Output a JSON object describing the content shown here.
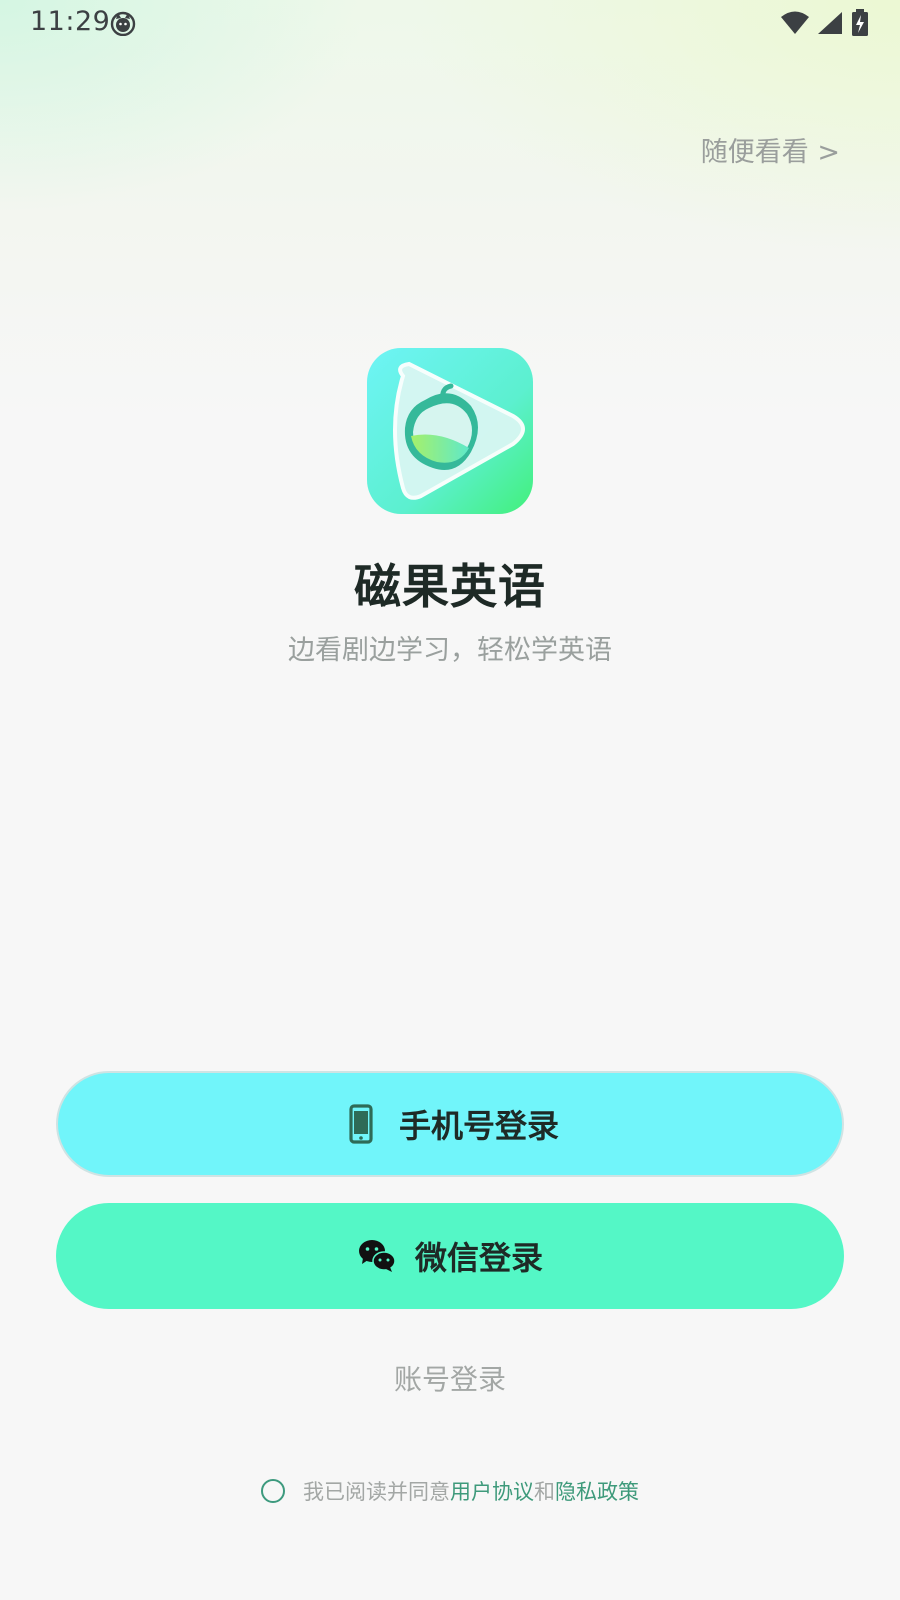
{
  "status_bar": {
    "time": "11:29",
    "icons": [
      "cat-notification-icon",
      "wifi-icon",
      "cell-signal-icon",
      "battery-charging-icon"
    ]
  },
  "skip": {
    "label": "随便看看 >"
  },
  "app": {
    "name": "磁果英语",
    "slogan": "边看剧边学习，轻松学英语",
    "logo_icon": "ciguo-logo-icon"
  },
  "buttons": {
    "phone_login": "手机号登录",
    "phone_icon": "smartphone-icon",
    "wechat_login": "微信登录",
    "wechat_icon": "wechat-icon",
    "account_login": "账号登录"
  },
  "agreement": {
    "prefix": "我已阅读并同意",
    "user_agreement": "用户协议",
    "conjunction": "和",
    "privacy_policy": "隐私政策"
  },
  "colors": {
    "phone_button": "#71f5fa",
    "wechat_button": "#54f7c6",
    "link": "#3e9a7b",
    "title": "#1e2a26",
    "muted": "#9aa09e"
  }
}
